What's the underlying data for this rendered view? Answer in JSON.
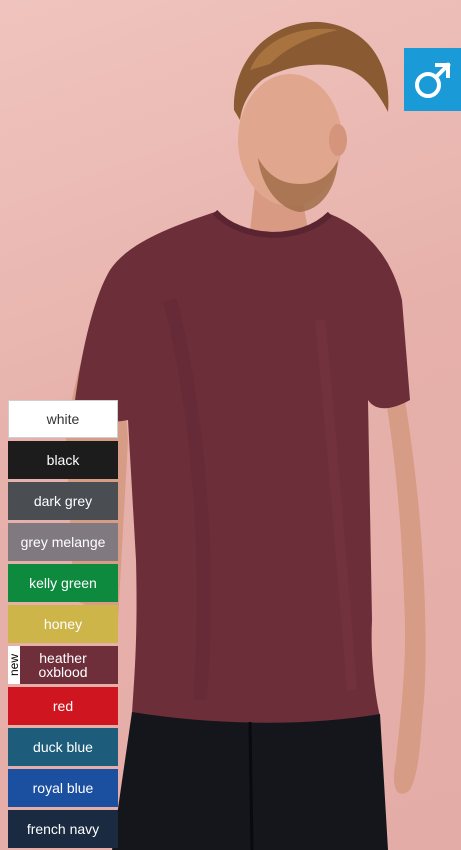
{
  "badge": {
    "icon": "male-symbol-icon",
    "color": "#1a9ad6",
    "glyph": "♂"
  },
  "new_label": "new",
  "colors": [
    {
      "label": "white",
      "hex": "#ffffff"
    },
    {
      "label": "black",
      "hex": "#1c1c1c"
    },
    {
      "label": "dark grey",
      "hex": "#4a4d52"
    },
    {
      "label": "grey melange",
      "hex": "#807a80"
    },
    {
      "label": "kelly green",
      "hex": "#0e8a3e"
    },
    {
      "label": "honey",
      "hex": "#cdb54a"
    },
    {
      "label": "heather\noxblood",
      "hex": "#6e2f3b",
      "new": true
    },
    {
      "label": "red",
      "hex": "#cf1620"
    },
    {
      "label": "duck blue",
      "hex": "#1d5c7a"
    },
    {
      "label": "royal blue",
      "hex": "#1b4fa0"
    },
    {
      "label": "french navy",
      "hex": "#1a2a40"
    }
  ]
}
